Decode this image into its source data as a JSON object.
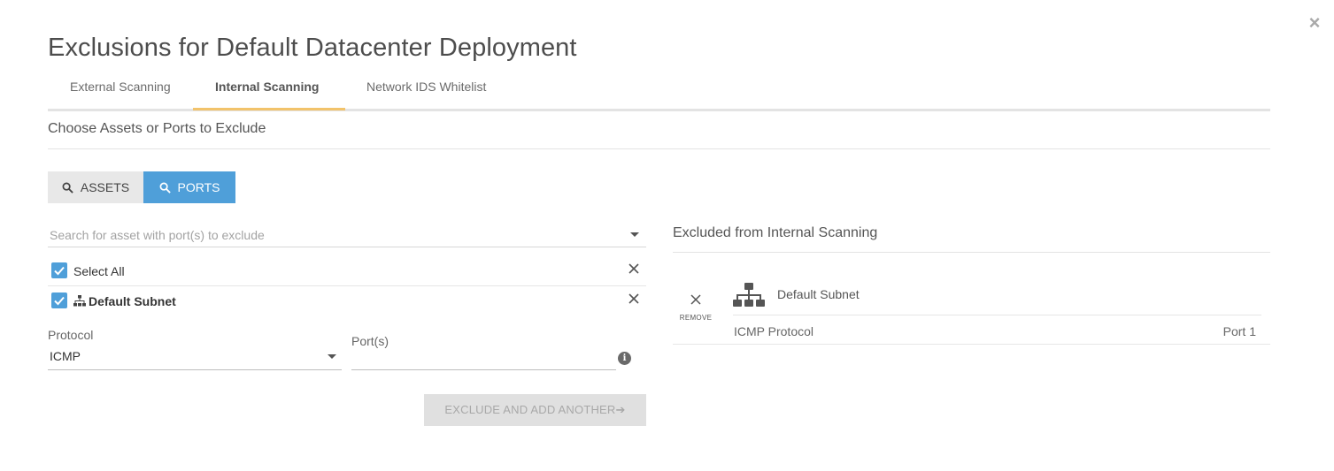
{
  "dialog": {
    "title": "Exclusions for Default Datacenter Deployment",
    "close_icon": "close-icon"
  },
  "tabs": [
    {
      "label": "External Scanning",
      "active": false
    },
    {
      "label": "Internal Scanning",
      "active": true
    },
    {
      "label": "Network IDS Whitelist",
      "active": false
    }
  ],
  "section": {
    "heading": "Choose Assets or Ports to Exclude"
  },
  "mode_toggle": {
    "assets_label": "ASSETS",
    "ports_label": "PORTS",
    "active": "PORTS",
    "active_color": "#4f9fd9"
  },
  "search": {
    "placeholder": "Search for asset with port(s) to exclude",
    "value": ""
  },
  "selection": {
    "select_all_label": "Select All",
    "select_all_checked": true,
    "subnet_label": "Default Subnet",
    "subnet_checked": true
  },
  "form": {
    "protocol_label": "Protocol",
    "protocol_value": "ICMP",
    "ports_label": "Port(s)",
    "ports_value": "",
    "submit_label": "EXCLUDE AND ADD ANOTHER➔"
  },
  "excluded": {
    "heading": "Excluded from Internal Scanning",
    "remove_label": "REMOVE",
    "items": [
      {
        "name": "Default Subnet",
        "protocol": "ICMP Protocol",
        "port": "Port 1"
      }
    ]
  },
  "colors": {
    "accent": "#4f9fd9",
    "tab_underline": "#f2c36b"
  }
}
